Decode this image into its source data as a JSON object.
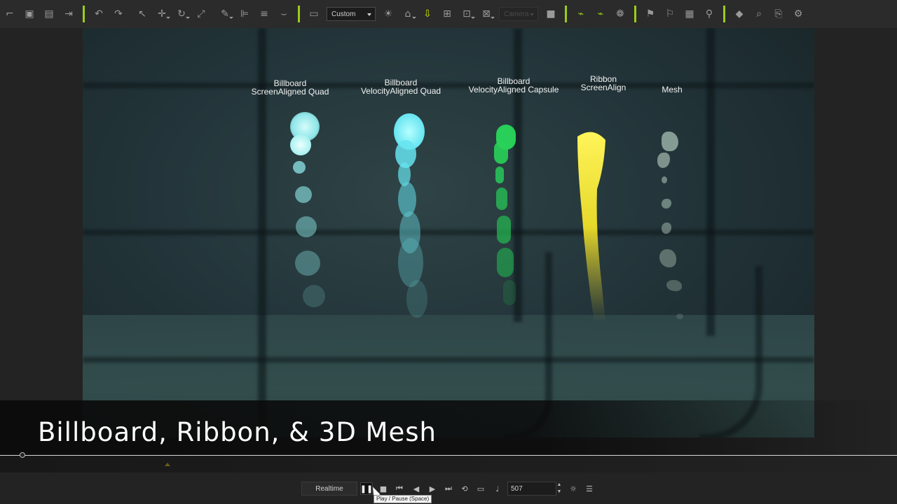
{
  "toolbar": {
    "view_preset": "Custom",
    "camera_preset": "Camera",
    "icons": [
      "undo-icon",
      "redo-icon",
      "select-icon",
      "move-icon",
      "rotate-icon",
      "scale-icon",
      "snap-icon",
      "align-icon",
      "distribute-icon",
      "visibility-icon",
      "layout-icon",
      "light-icon",
      "home-icon",
      "fit-icon",
      "frame-icon",
      "zoom-extents-icon",
      "frame-selected-icon",
      "camera-icon",
      "path-icon",
      "bone-icon",
      "effect-icon",
      "gizmo-icon",
      "flag-icon",
      "clipboard-icon",
      "link-icon",
      "keyframe-icon",
      "search-icon",
      "export-icon",
      "settings-icon"
    ]
  },
  "viewport": {
    "labels": [
      {
        "line1": "Billboard",
        "line2": "ScreenAligned Quad"
      },
      {
        "line1": "Billboard",
        "line2": "VelocityAligned Quad"
      },
      {
        "line1": "Billboard",
        "line2": "VelocityAligned Capsule"
      },
      {
        "line1": "Ribbon",
        "line2": "ScreenAlign"
      },
      {
        "line1": "Mesh",
        "line2": ""
      }
    ],
    "colors": {
      "quad": "#8fe6e8",
      "velocity_quad": "#66e4f0",
      "capsule": "#26d05a",
      "ribbon": "#f0e030",
      "mesh": "#8fa7a0"
    }
  },
  "caption": "Billboard, Ribbon, & 3D Mesh",
  "playback": {
    "mode": "Realtime",
    "frame": "507",
    "tooltip": "Play / Pause (Space)"
  }
}
